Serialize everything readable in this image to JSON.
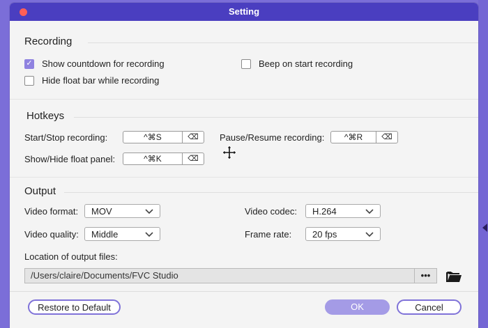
{
  "window": {
    "title": "Setting"
  },
  "recording": {
    "heading": "Recording",
    "show_countdown": {
      "label": "Show countdown for recording",
      "checked": true
    },
    "hide_float_bar": {
      "label": "Hide float bar while recording",
      "checked": false
    },
    "beep_on_start": {
      "label": "Beep on start recording",
      "checked": false
    }
  },
  "hotkeys": {
    "heading": "Hotkeys",
    "start_stop": {
      "label": "Start/Stop recording:",
      "keys": "^⌘S"
    },
    "pause_resume": {
      "label": "Pause/Resume recording:",
      "keys": "^⌘R"
    },
    "show_hide_panel": {
      "label": "Show/Hide float panel:",
      "keys": "^⌘K"
    },
    "clear_symbol": "⌫"
  },
  "output": {
    "heading": "Output",
    "video_format": {
      "label": "Video format:",
      "value": "MOV"
    },
    "video_quality": {
      "label": "Video quality:",
      "value": "Middle"
    },
    "video_codec": {
      "label": "Video codec:",
      "value": "H.264"
    },
    "frame_rate": {
      "label": "Frame rate:",
      "value": "20 fps"
    },
    "location_label": "Location of output files:",
    "location_path": "/Users/claire/Documents/FVC Studio",
    "browse_label": "•••"
  },
  "footer": {
    "restore_label": "Restore to Default",
    "ok_label": "OK",
    "cancel_label": "Cancel"
  },
  "colors": {
    "accent": "#8f82e0",
    "titlebar": "#4a3ec0",
    "background": "#7b6ed8"
  }
}
